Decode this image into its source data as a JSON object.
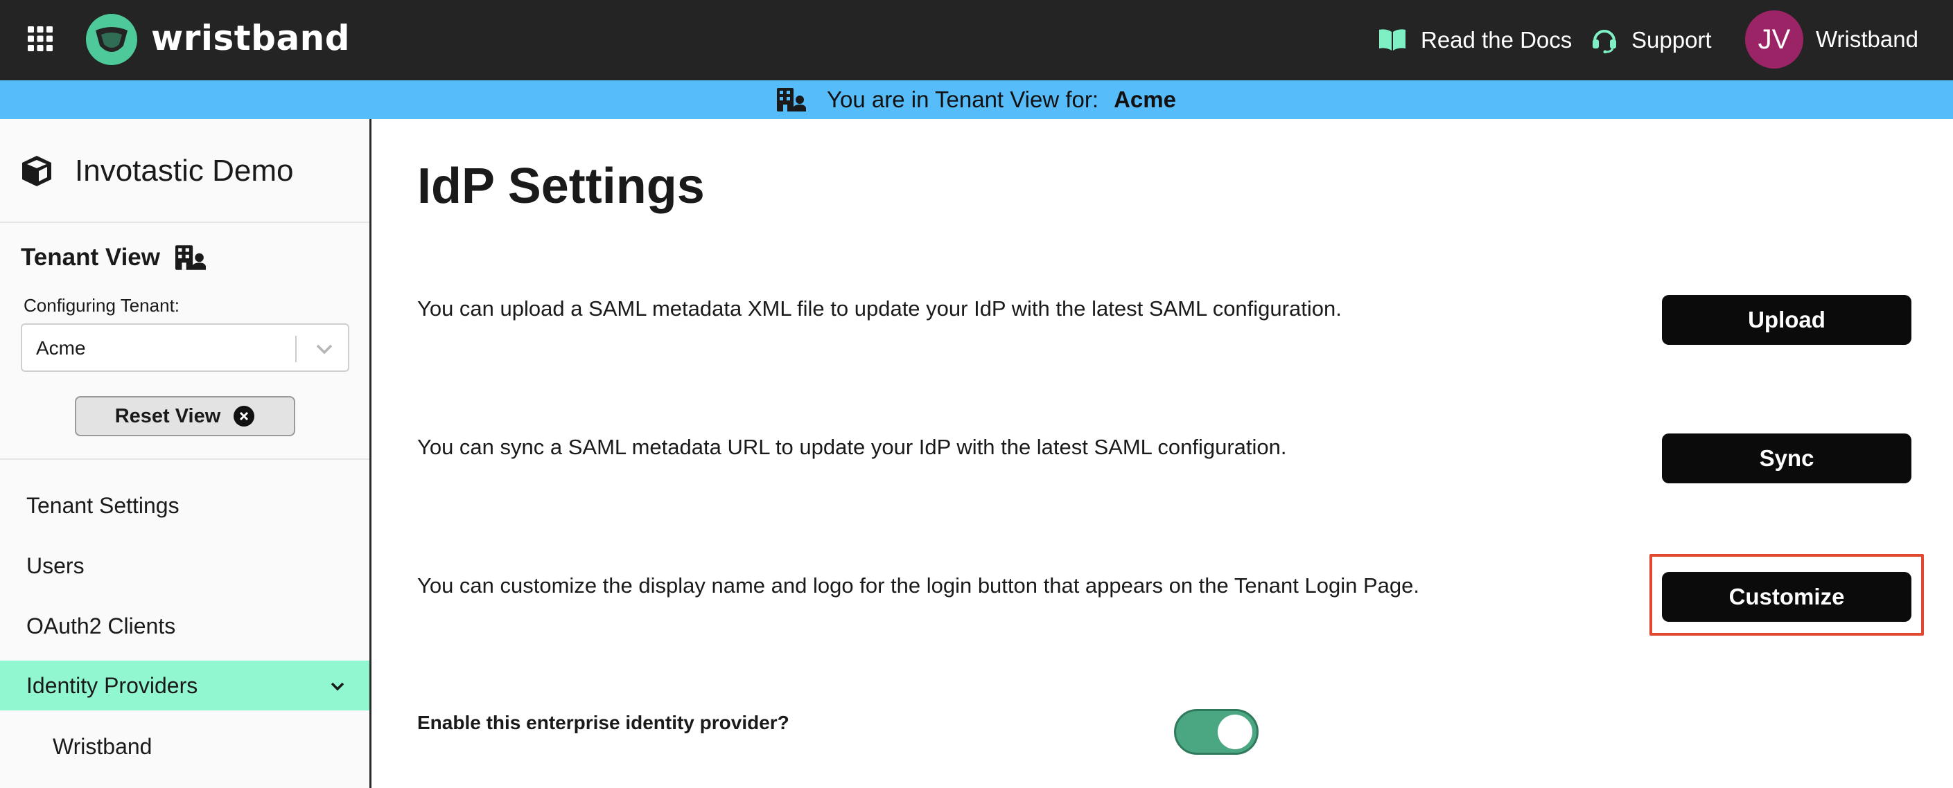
{
  "header": {
    "brand": "wristband",
    "docs_label": "Read the Docs",
    "support_label": "Support",
    "user_initials": "JV",
    "user_name": "Wristband"
  },
  "banner": {
    "text": "You are in Tenant View for:",
    "tenant": "Acme"
  },
  "sidebar": {
    "app_name": "Invotastic Demo",
    "tenant_view_title": "Tenant View",
    "config_label": "Configuring Tenant:",
    "selected_tenant": "Acme",
    "reset_label": "Reset View",
    "nav": [
      {
        "label": "Tenant Settings"
      },
      {
        "label": "Users"
      },
      {
        "label": "OAuth2 Clients"
      },
      {
        "label": "Identity Providers",
        "active": true
      },
      {
        "label": "Wristband"
      }
    ]
  },
  "main": {
    "title": "IdP Settings",
    "rows": [
      {
        "text": "You can upload a SAML metadata XML file to update your IdP with the latest SAML configuration.",
        "button": "Upload"
      },
      {
        "text": "You can sync a SAML metadata URL to update your IdP with the latest SAML configuration.",
        "button": "Sync"
      },
      {
        "text": "You can customize the display name and logo for the login button that appears on the Tenant Login Page.",
        "button": "Customize"
      }
    ],
    "enable_label": "Enable this enterprise identity provider?",
    "enable_on": true
  },
  "colors": {
    "topbar": "#242424",
    "banner": "#56bcfa",
    "accent": "#90f7d0",
    "toggle_on": "#4aa782",
    "avatar": "#9a2466",
    "highlight": "#e2472f"
  }
}
